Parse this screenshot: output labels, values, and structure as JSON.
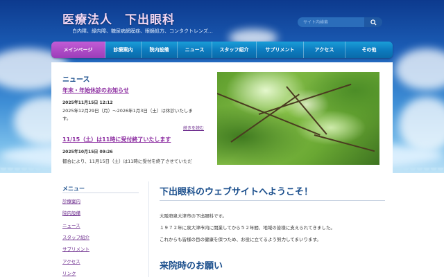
{
  "header": {
    "title": "医療法人　下出眼科",
    "subtitle": "白内障、緑内障、糖尿病網膜症、眼鏡処方、コンタクトレンズ…",
    "search_placeholder": "サイト内検索"
  },
  "nav": [
    {
      "label": "メインページ",
      "active": true
    },
    {
      "label": "診療案内",
      "active": false
    },
    {
      "label": "院内設備",
      "active": false
    },
    {
      "label": "ニュース",
      "active": false
    },
    {
      "label": "スタッフ紹介",
      "active": false
    },
    {
      "label": "サプリメント",
      "active": false
    },
    {
      "label": "アクセス",
      "active": false
    },
    {
      "label": "その他",
      "active": false
    }
  ],
  "news": {
    "heading": "ニュース",
    "items": [
      {
        "title": "年末・年始休診のお知らせ",
        "date": "2025年11月15日 12:12",
        "body": "2025年12月29日（月）〜2026年1月3日（土）は休診いたします。"
      },
      {
        "title": "11/15（土）は11時に受付終了いたします",
        "date": "2025年10月15日 09:26",
        "body": "都合により、11月15日（土）は11時に受付を終了させていただ"
      }
    ],
    "more": "続きを読む"
  },
  "sidebar": {
    "heading": "メニュー",
    "links": [
      "診療案内",
      "院内設備",
      "ニュース",
      "スタッフ紹介",
      "サプリメント",
      "アクセス",
      "リンク"
    ]
  },
  "main": {
    "welcome": "下出眼科のウェブサイトへようこそ！",
    "paragraphs": [
      "大阪府泉大津市の下出眼科です。",
      "１９７２年に泉大津市内に開業してから５２年間、地域の皆様に支えられてきました。",
      "これからも皆様の目の健康を保つため、お役に立てるよう努力してまいります。"
    ],
    "section2": "来院時のお願い"
  },
  "colors": {
    "accent_purple": "#9b3db8",
    "nav_blue": "#0d7cc0",
    "heading_blue": "#1a4e8c",
    "link_purple": "#6b2a8c"
  }
}
